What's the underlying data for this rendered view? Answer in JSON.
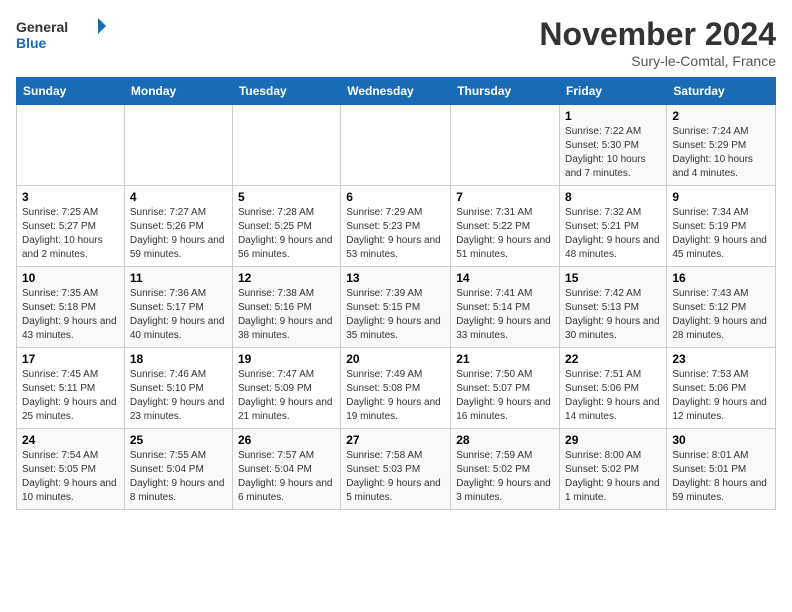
{
  "logo": {
    "text_general": "General",
    "text_blue": "Blue"
  },
  "header": {
    "month": "November 2024",
    "location": "Sury-le-Comtal, France"
  },
  "weekdays": [
    "Sunday",
    "Monday",
    "Tuesday",
    "Wednesday",
    "Thursday",
    "Friday",
    "Saturday"
  ],
  "weeks": [
    [
      {
        "day": "",
        "info": ""
      },
      {
        "day": "",
        "info": ""
      },
      {
        "day": "",
        "info": ""
      },
      {
        "day": "",
        "info": ""
      },
      {
        "day": "",
        "info": ""
      },
      {
        "day": "1",
        "info": "Sunrise: 7:22 AM\nSunset: 5:30 PM\nDaylight: 10 hours and 7 minutes."
      },
      {
        "day": "2",
        "info": "Sunrise: 7:24 AM\nSunset: 5:29 PM\nDaylight: 10 hours and 4 minutes."
      }
    ],
    [
      {
        "day": "3",
        "info": "Sunrise: 7:25 AM\nSunset: 5:27 PM\nDaylight: 10 hours and 2 minutes."
      },
      {
        "day": "4",
        "info": "Sunrise: 7:27 AM\nSunset: 5:26 PM\nDaylight: 9 hours and 59 minutes."
      },
      {
        "day": "5",
        "info": "Sunrise: 7:28 AM\nSunset: 5:25 PM\nDaylight: 9 hours and 56 minutes."
      },
      {
        "day": "6",
        "info": "Sunrise: 7:29 AM\nSunset: 5:23 PM\nDaylight: 9 hours and 53 minutes."
      },
      {
        "day": "7",
        "info": "Sunrise: 7:31 AM\nSunset: 5:22 PM\nDaylight: 9 hours and 51 minutes."
      },
      {
        "day": "8",
        "info": "Sunrise: 7:32 AM\nSunset: 5:21 PM\nDaylight: 9 hours and 48 minutes."
      },
      {
        "day": "9",
        "info": "Sunrise: 7:34 AM\nSunset: 5:19 PM\nDaylight: 9 hours and 45 minutes."
      }
    ],
    [
      {
        "day": "10",
        "info": "Sunrise: 7:35 AM\nSunset: 5:18 PM\nDaylight: 9 hours and 43 minutes."
      },
      {
        "day": "11",
        "info": "Sunrise: 7:36 AM\nSunset: 5:17 PM\nDaylight: 9 hours and 40 minutes."
      },
      {
        "day": "12",
        "info": "Sunrise: 7:38 AM\nSunset: 5:16 PM\nDaylight: 9 hours and 38 minutes."
      },
      {
        "day": "13",
        "info": "Sunrise: 7:39 AM\nSunset: 5:15 PM\nDaylight: 9 hours and 35 minutes."
      },
      {
        "day": "14",
        "info": "Sunrise: 7:41 AM\nSunset: 5:14 PM\nDaylight: 9 hours and 33 minutes."
      },
      {
        "day": "15",
        "info": "Sunrise: 7:42 AM\nSunset: 5:13 PM\nDaylight: 9 hours and 30 minutes."
      },
      {
        "day": "16",
        "info": "Sunrise: 7:43 AM\nSunset: 5:12 PM\nDaylight: 9 hours and 28 minutes."
      }
    ],
    [
      {
        "day": "17",
        "info": "Sunrise: 7:45 AM\nSunset: 5:11 PM\nDaylight: 9 hours and 25 minutes."
      },
      {
        "day": "18",
        "info": "Sunrise: 7:46 AM\nSunset: 5:10 PM\nDaylight: 9 hours and 23 minutes."
      },
      {
        "day": "19",
        "info": "Sunrise: 7:47 AM\nSunset: 5:09 PM\nDaylight: 9 hours and 21 minutes."
      },
      {
        "day": "20",
        "info": "Sunrise: 7:49 AM\nSunset: 5:08 PM\nDaylight: 9 hours and 19 minutes."
      },
      {
        "day": "21",
        "info": "Sunrise: 7:50 AM\nSunset: 5:07 PM\nDaylight: 9 hours and 16 minutes."
      },
      {
        "day": "22",
        "info": "Sunrise: 7:51 AM\nSunset: 5:06 PM\nDaylight: 9 hours and 14 minutes."
      },
      {
        "day": "23",
        "info": "Sunrise: 7:53 AM\nSunset: 5:06 PM\nDaylight: 9 hours and 12 minutes."
      }
    ],
    [
      {
        "day": "24",
        "info": "Sunrise: 7:54 AM\nSunset: 5:05 PM\nDaylight: 9 hours and 10 minutes."
      },
      {
        "day": "25",
        "info": "Sunrise: 7:55 AM\nSunset: 5:04 PM\nDaylight: 9 hours and 8 minutes."
      },
      {
        "day": "26",
        "info": "Sunrise: 7:57 AM\nSunset: 5:04 PM\nDaylight: 9 hours and 6 minutes."
      },
      {
        "day": "27",
        "info": "Sunrise: 7:58 AM\nSunset: 5:03 PM\nDaylight: 9 hours and 5 minutes."
      },
      {
        "day": "28",
        "info": "Sunrise: 7:59 AM\nSunset: 5:02 PM\nDaylight: 9 hours and 3 minutes."
      },
      {
        "day": "29",
        "info": "Sunrise: 8:00 AM\nSunset: 5:02 PM\nDaylight: 9 hours and 1 minute."
      },
      {
        "day": "30",
        "info": "Sunrise: 8:01 AM\nSunset: 5:01 PM\nDaylight: 8 hours and 59 minutes."
      }
    ]
  ]
}
